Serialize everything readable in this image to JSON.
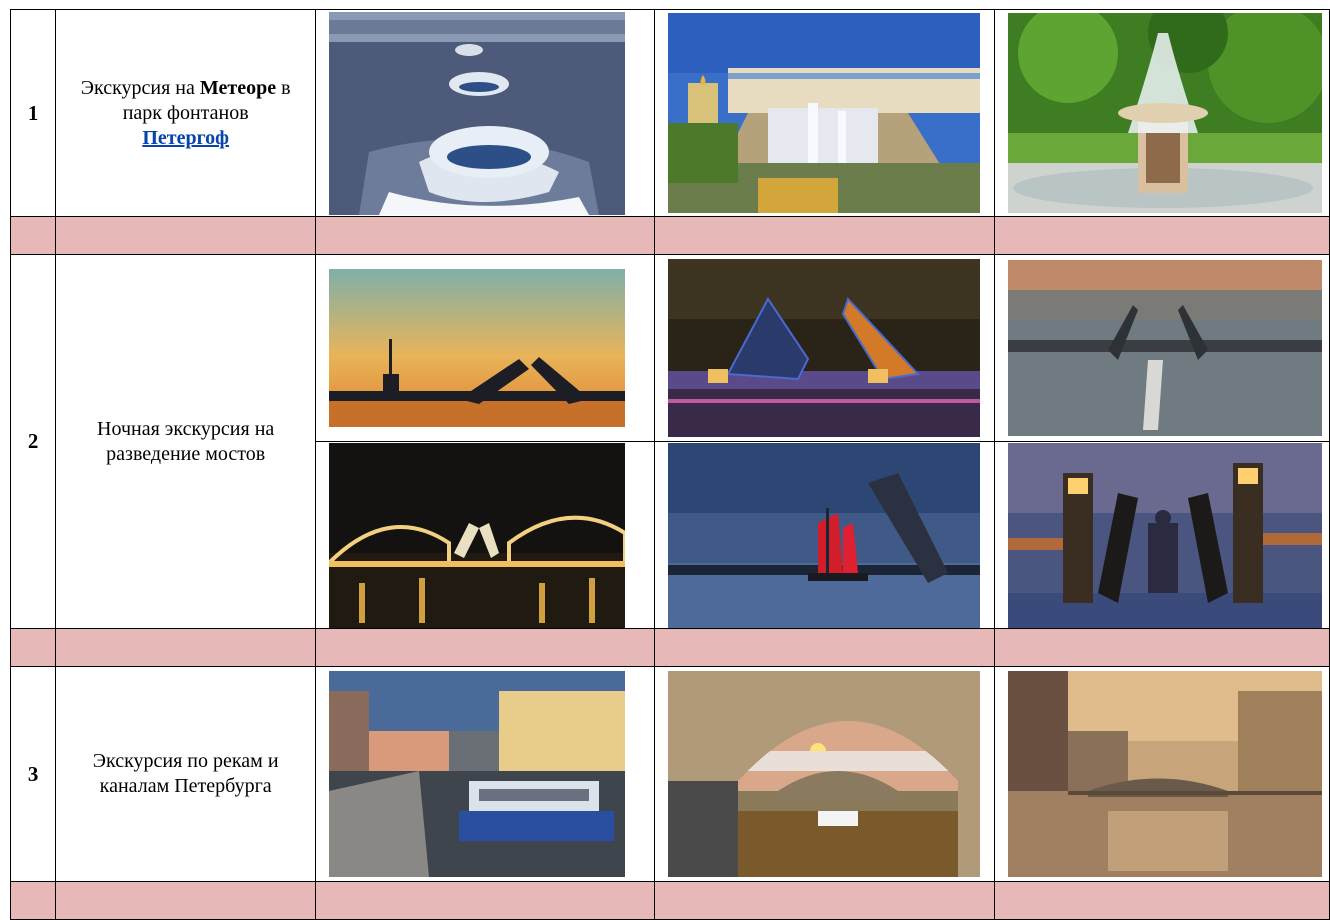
{
  "rows": [
    {
      "number": "1",
      "desc_pre": "Экскурсия на ",
      "desc_bold": "Метеоре",
      "desc_post": " в парк фонтанов",
      "link": "Петергоф",
      "photos": [
        "hydrofoil-on-river",
        "peterhof-grand-cascade",
        "peterhof-roman-fountain"
      ]
    },
    {
      "number": "2",
      "desc": "Ночная экскурсия на разведение мостов",
      "photos": [
        "bridge-sunset-silhouette",
        "palace-bridge-raised-night",
        "bridge-aerial-dusk",
        "illuminated-bridge-night",
        "scarlet-sails-bridge",
        "bolsheokhtinsky-bridge-towers"
      ]
    },
    {
      "number": "3",
      "desc": "Экскурсия по рекам и каналам Петербурга",
      "photos": [
        "canal-tour-boat",
        "winter-canal-arch",
        "fontanka-morning-mist"
      ]
    }
  ],
  "colors": {
    "separator": "#e6b8b7",
    "link": "#0645ad"
  }
}
